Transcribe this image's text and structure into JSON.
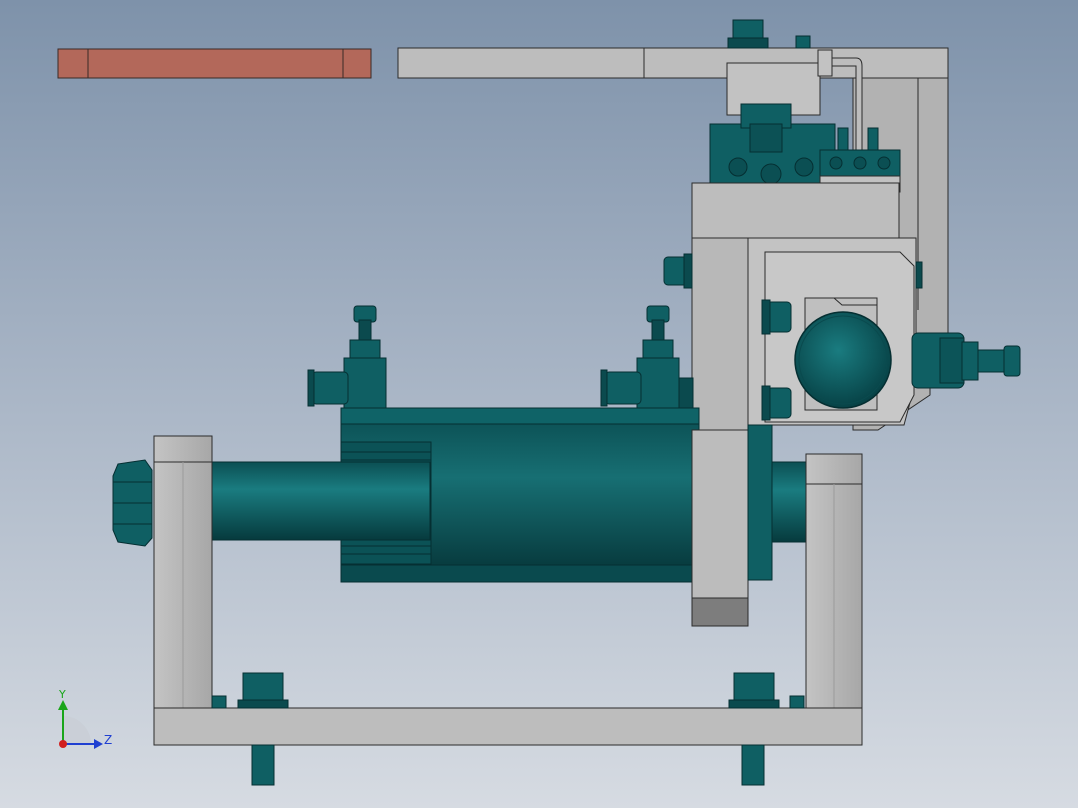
{
  "colors": {
    "frame_gray": "#b7b7b7",
    "frame_gray_dark": "#8f8f8f",
    "teal": "#0f5f63",
    "teal_light": "#19797d",
    "teal_dark": "#073c40",
    "copper": "#b56a5c",
    "outline": "#2b2b2b",
    "axis_y": "#1aa51a",
    "axis_z": "#1f3fd1",
    "axis_origin": "#d11f1f"
  },
  "triad": {
    "y_label": "Y",
    "z_label": "Z"
  },
  "icons": {
    "triad": "coordinate-triad-icon"
  }
}
